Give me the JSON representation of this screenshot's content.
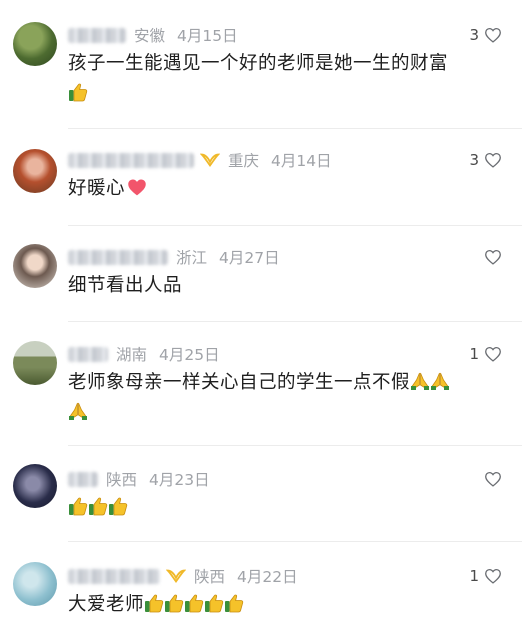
{
  "comments": [
    {
      "username": "Young",
      "location": "安徽",
      "date": "4月15日",
      "likes": "3",
      "text": "孩子一生能遇见一个好的老师是她一生的财富",
      "text_line2": "",
      "emojis": [
        "thumbs-up"
      ],
      "colors": {
        "avatar": "#5a7a3a"
      }
    },
    {
      "username": "",
      "location": "重庆",
      "date": "4月14日",
      "likes": "3",
      "text": "好暖心",
      "text_line2": "",
      "emojis": [
        "red-heart"
      ],
      "colors": {
        "avatar": "#c0705a"
      }
    },
    {
      "username": "",
      "location": "浙江",
      "date": "4月27日",
      "likes": "",
      "text": "细节看出人品",
      "text_line2": "",
      "emojis": [],
      "colors": {
        "avatar": "#7a6a60"
      }
    },
    {
      "username": "",
      "location": "湖南",
      "date": "4月25日",
      "likes": "1",
      "text": "老师象母亲一样关心自己的学生一点不假",
      "text_line2": "",
      "emojis": [
        "folded-hands",
        "folded-hands",
        "folded-hands"
      ],
      "colors": {
        "avatar": "#6f7d55"
      }
    },
    {
      "username": "",
      "location": "陕西",
      "date": "4月23日",
      "likes": "",
      "text": "",
      "text_line2": "",
      "emojis": [
        "thumbs-up",
        "thumbs-up",
        "thumbs-up"
      ],
      "colors": {
        "avatar": "#3c3f5e"
      }
    },
    {
      "username": "",
      "location": "陕西",
      "date": "4月22日",
      "likes": "1",
      "text": "大爱老师",
      "text_line2": "",
      "emojis": [
        "thumbs-up",
        "thumbs-up",
        "thumbs-up",
        "thumbs-up",
        "thumbs-up"
      ],
      "colors": {
        "avatar": "#7fb8c8"
      }
    }
  ],
  "colors": {
    "meta_text": "#a0a3a8",
    "body_text": "#1f1f1f",
    "badge": "#f0b92a",
    "heart": "#f2556b",
    "separator": "#ececec"
  }
}
